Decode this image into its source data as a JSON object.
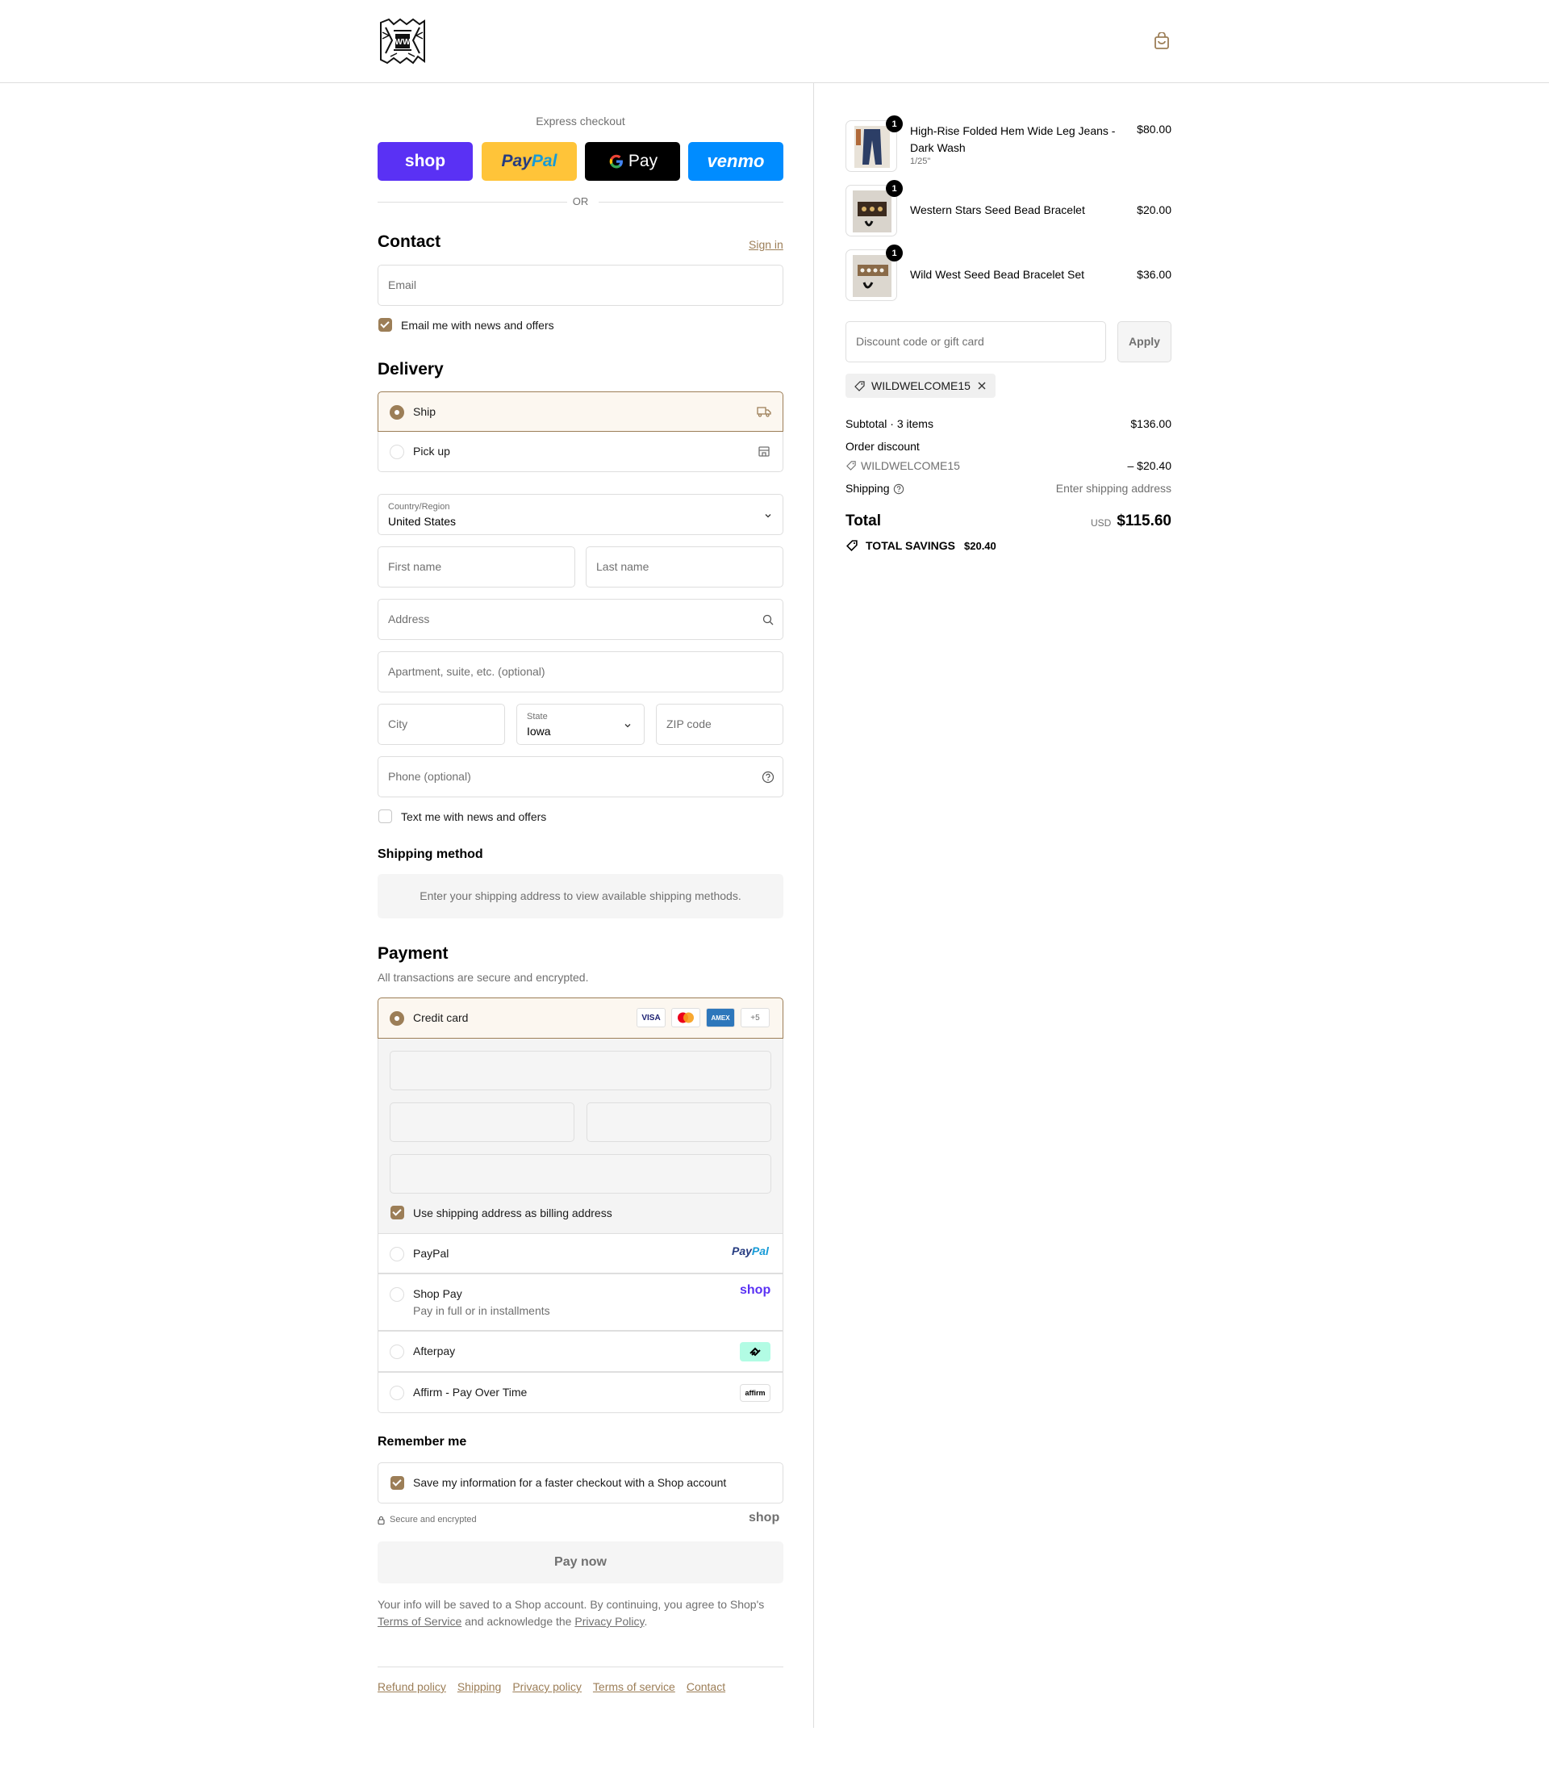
{
  "header": {
    "logo_alt": "Wild West logo",
    "cart_icon": "shopping-bag-icon"
  },
  "express": {
    "title": "Express checkout",
    "or": "OR",
    "buttons": [
      {
        "label": "shop",
        "color": "#5a31f4"
      },
      {
        "label": "PayPal",
        "color": "#ffc439"
      },
      {
        "label": "G Pay",
        "color": "#000000"
      },
      {
        "label": "venmo",
        "color": "#008cff"
      }
    ]
  },
  "contact": {
    "title": "Contact",
    "sign_in": "Sign in",
    "email_placeholder": "Email",
    "news_label": "Email me with news and offers",
    "news_checked": true
  },
  "delivery": {
    "title": "Delivery",
    "options": [
      {
        "label": "Ship",
        "selected": true,
        "icon": "truck-icon"
      },
      {
        "label": "Pick up",
        "selected": false,
        "icon": "store-icon"
      }
    ],
    "country_label": "Country/Region",
    "country_value": "United States",
    "first_name": "First name",
    "last_name": "Last name",
    "address": "Address",
    "apartment": "Apartment, suite, etc. (optional)",
    "city": "City",
    "state_label": "State",
    "state_value": "Iowa",
    "zip": "ZIP code",
    "phone": "Phone (optional)",
    "text_label": "Text me with news and offers",
    "text_checked": false
  },
  "shipping_method": {
    "title": "Shipping method",
    "message": "Enter your shipping address to view available shipping methods."
  },
  "payment": {
    "title": "Payment",
    "subtitle": "All transactions are secure and encrypted.",
    "credit_card_label": "Credit card",
    "card_badges": [
      "VISA",
      "MC",
      "AMEX",
      "+5"
    ],
    "billing_label": "Use shipping address as billing address",
    "billing_checked": true,
    "methods": [
      {
        "label": "PayPal",
        "sub": "",
        "logo": "PayPal"
      },
      {
        "label": "Shop Pay",
        "sub": "Pay in full or in installments",
        "logo": "shop"
      },
      {
        "label": "Afterpay",
        "sub": "",
        "logo": "afterpay-icon"
      },
      {
        "label": "Affirm - Pay Over Time",
        "sub": "",
        "logo": "affirm"
      }
    ]
  },
  "remember": {
    "title": "Remember me",
    "save_label": "Save my information for a faster checkout with a Shop account",
    "save_checked": true,
    "secure": "Secure and encrypted",
    "shop_logo": "shop"
  },
  "pay_button": "Pay now",
  "legal": {
    "line1": "Your info will be saved to a Shop account. By continuing, you agree to Shop's",
    "terms": "Terms of Service",
    "and": " and acknowledge the ",
    "privacy": "Privacy Policy",
    "end": "."
  },
  "footer_links": [
    "Refund policy",
    "Shipping",
    "Privacy policy",
    "Terms of service",
    "Contact"
  ],
  "cart": {
    "items": [
      {
        "name_line1": "High-Rise Folded Hem Wide Leg Jeans -",
        "name_line2": "Dark Wash",
        "variant": "1/25\"",
        "price": "$80.00",
        "qty": "1"
      },
      {
        "name_line1": "Western Stars Seed Bead Bracelet",
        "name_line2": "",
        "variant": "",
        "price": "$20.00",
        "qty": "1"
      },
      {
        "name_line1": "Wild West Seed Bead Bracelet Set",
        "name_line2": "",
        "variant": "",
        "price": "$36.00",
        "qty": "1"
      }
    ],
    "discount_placeholder": "Discount code or gift card",
    "apply": "Apply",
    "applied_code": "WILDWELCOME15",
    "subtotal_label": "Subtotal · 3 items",
    "subtotal_value": "$136.00",
    "order_discount_label": "Order discount",
    "discount_code": "WILDWELCOME15",
    "discount_value": "– $20.40",
    "shipping_label": "Shipping",
    "shipping_value": "Enter shipping address",
    "total_label": "Total",
    "currency": "USD",
    "total_value": "$115.60",
    "savings_label": "TOTAL SAVINGS",
    "savings_value": "$20.40"
  },
  "colors": {
    "accent": "#9c7e57",
    "border": "#dedede",
    "muted": "#707070"
  }
}
